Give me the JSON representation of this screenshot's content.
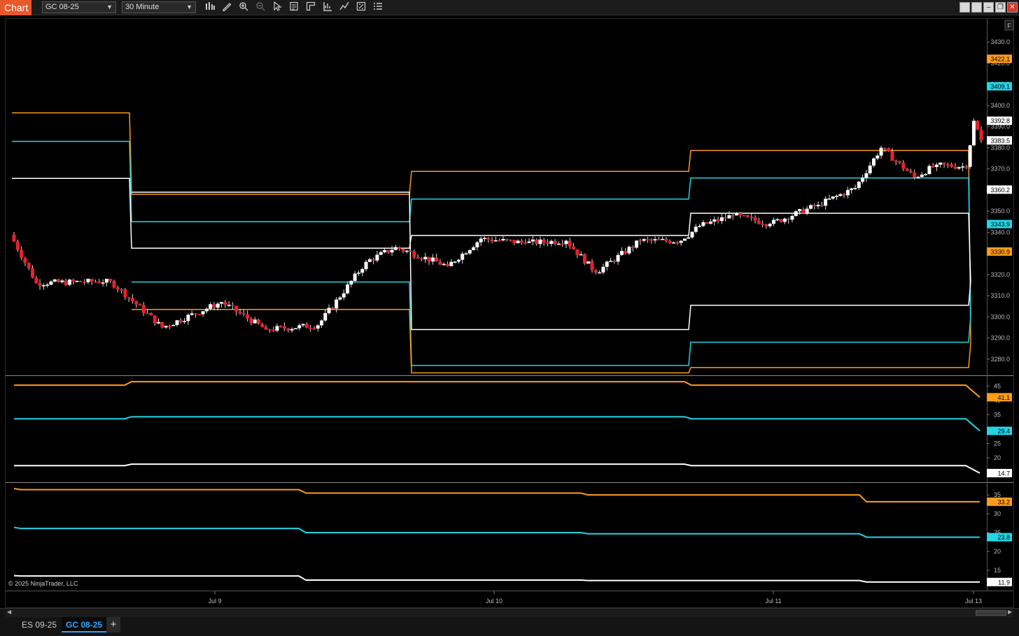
{
  "window": {
    "title": "Chart",
    "instrument": "GC 08-25",
    "interval": "30 Minute",
    "toolbar_icons": [
      "bar-type-icon",
      "draw-tool-icon",
      "zoom-in-icon",
      "zoom-out-icon",
      "pointer-icon",
      "data-box-icon",
      "templates-icon",
      "strategies-icon",
      "indicators-icon",
      "properties-icon",
      "menu-icon"
    ],
    "window_buttons": [
      "tile-icon",
      "restore-icon",
      "minimize-icon",
      "maximize-icon",
      "close-icon"
    ]
  },
  "colors": {
    "background": "#000000",
    "orange": "#ff9c1a",
    "cyan": "#22d6e6",
    "white": "#ffffff",
    "bull_candle": "#ffffff",
    "bear_candle": "#e8202a",
    "accent": "#e8582b",
    "tab_active": "#2fa6ff"
  },
  "chart_data": [
    {
      "type": "candlestick",
      "panel": "price",
      "instrument": "GC 08-25",
      "interval": "30 Minute",
      "x_ticks": [
        "Jul 9",
        "Jul 10",
        "Jul 11",
        "Jul 13"
      ],
      "y_ticks": [
        3280.0,
        3290.0,
        3300.0,
        3310.0,
        3320.0,
        3330.0,
        3340.0,
        3350.0,
        3360.0,
        3370.0,
        3380.0,
        3390.0,
        3400.0,
        3410.0,
        3420.0,
        3430.0
      ],
      "ylim": [
        3273,
        3440
      ],
      "price_markers": [
        {
          "label": "3422.1",
          "color": "orange"
        },
        {
          "label": "3409.1",
          "color": "cyan"
        },
        {
          "label": "3392.8",
          "color": "white"
        },
        {
          "label": "3383.5",
          "color": "white"
        },
        {
          "label": "3360.2",
          "color": "white"
        },
        {
          "label": "3343.9",
          "color": "cyan"
        },
        {
          "label": "3330.9",
          "color": "orange"
        }
      ],
      "series": [
        {
          "color": "orange",
          "segments": [
            [
              3396.5,
              3358.0
            ],
            [
              3358.0,
              3368.8
            ],
            [
              3368.8,
              3378.7
            ],
            [
              3378.7,
              3287.6
            ],
            [
              3287.6,
              3422.1
            ]
          ]
        },
        {
          "color": "cyan",
          "segments": [
            [
              3383.0,
              3345.0
            ],
            [
              3345.0,
              3355.7
            ],
            [
              3355.7,
              3365.7
            ],
            [
              3365.7,
              3300.7
            ],
            [
              3300.7,
              3409.1
            ]
          ]
        },
        {
          "color": "white",
          "segments": [
            [
              3365.5,
              3332.5
            ],
            [
              3332.5,
              3338.5
            ],
            [
              3338.5,
              3349.0
            ],
            [
              3349.0,
              3316.7
            ],
            [
              3316.7,
              3392.8
            ]
          ]
        },
        {
          "color": "white",
          "segments": [
            [
              3359.0,
              3294.0
            ],
            [
              3294.0,
              3305.5
            ],
            [
              3305.5,
              3316.7
            ]
          ]
        },
        {
          "color": "cyan",
          "segments": [
            [
              3316.5,
              3277.0
            ],
            [
              3277.0,
              3288.0
            ],
            [
              3288.0,
              3300.7
            ]
          ]
        },
        {
          "color": "orange",
          "segments": [
            [
              3303.5,
              3273.5
            ],
            [
              3273.5,
              3276.0
            ],
            [
              3276.0,
              3287.6
            ]
          ]
        }
      ],
      "ohlc_segments": [
        {
          "start": 3339,
          "end": 3316,
          "low": 3305,
          "high": 3341
        },
        {
          "start": 3316,
          "end": 3317,
          "low": 3310,
          "high": 3318
        },
        {
          "start": 3317,
          "end": 3295,
          "low": 3292,
          "high": 3318
        },
        {
          "start": 3295,
          "end": 3307,
          "low": 3292,
          "high": 3307
        },
        {
          "start": 3307,
          "end": 3294,
          "low": 3290,
          "high": 3308
        },
        {
          "start": 3294,
          "end": 3296,
          "low": 3291,
          "high": 3310
        },
        {
          "start": 3296,
          "end": 3326,
          "low": 3294,
          "high": 3327
        },
        {
          "start": 3326,
          "end": 3333,
          "low": 3324,
          "high": 3336
        },
        {
          "start": 3333,
          "end": 3324,
          "low": 3322,
          "high": 3335
        },
        {
          "start": 3324,
          "end": 3337,
          "low": 3322,
          "high": 3338
        },
        {
          "start": 3337,
          "end": 3335,
          "low": 3332,
          "high": 3340
        },
        {
          "start": 3335,
          "end": 3336,
          "low": 3329,
          "high": 3340
        },
        {
          "start": 3336,
          "end": 3321,
          "low": 3319,
          "high": 3340
        },
        {
          "start": 3321,
          "end": 3336,
          "low": 3320,
          "high": 3337
        },
        {
          "start": 3336,
          "end": 3336,
          "low": 3333,
          "high": 3338
        },
        {
          "start": 3336,
          "end": 3343,
          "low": 3337,
          "high": 3344
        },
        {
          "start": 3343,
          "end": 3348,
          "low": 3340,
          "high": 3350
        },
        {
          "start": 3348,
          "end": 3344,
          "low": 3341,
          "high": 3355
        },
        {
          "start": 3344,
          "end": 3353,
          "low": 3342,
          "high": 3355
        },
        {
          "start": 3353,
          "end": 3361,
          "low": 3350,
          "high": 3366
        },
        {
          "start": 3361,
          "end": 3380,
          "low": 3360,
          "high": 3381
        },
        {
          "start": 3380,
          "end": 3366,
          "low": 3362,
          "high": 3381
        },
        {
          "start": 3366,
          "end": 3372,
          "low": 3364,
          "high": 3374
        },
        {
          "start": 3372,
          "end": 3371,
          "low": 3368,
          "high": 3373
        },
        {
          "start": 3371,
          "end": 3392.8,
          "low": 3368,
          "high": 3394
        },
        {
          "start": 3392.8,
          "end": 3383.5,
          "low": 3381,
          "high": 3393
        }
      ],
      "candle_counts": [
        7,
        20,
        14,
        16,
        12,
        14,
        13,
        8,
        14,
        9,
        12,
        11,
        8,
        12,
        11,
        5,
        9,
        10,
        13,
        10,
        7,
        9,
        6,
        8,
        2,
        2
      ]
    },
    {
      "type": "line",
      "panel": "indicator-1",
      "y_ticks": [
        20,
        25,
        30,
        35,
        40,
        45
      ],
      "ylim": [
        12,
        48
      ],
      "price_markers": [
        {
          "label": "41.1",
          "color": "orange"
        },
        {
          "label": "29.4",
          "color": "cyan"
        },
        {
          "label": "14.7",
          "color": "white"
        }
      ],
      "series": [
        {
          "color": "orange",
          "levels": [
            45.3,
            46.5,
            46.5,
            45.3,
            45.3,
            41.1
          ]
        },
        {
          "color": "cyan",
          "levels": [
            33.6,
            34.3,
            34.3,
            33.6,
            33.6,
            29.4
          ]
        },
        {
          "color": "white",
          "levels": [
            17.3,
            17.8,
            17.8,
            17.3,
            17.3,
            14.7
          ]
        }
      ]
    },
    {
      "type": "line",
      "panel": "indicator-2",
      "y_ticks": [
        15,
        20,
        25,
        30,
        35
      ],
      "ylim": [
        10,
        38
      ],
      "price_markers": [
        {
          "label": "33.2",
          "color": "orange"
        },
        {
          "label": "23.8",
          "color": "cyan"
        },
        {
          "label": "11.9",
          "color": "white"
        }
      ],
      "series": [
        {
          "color": "orange",
          "levels": [
            36.7,
            36.4,
            35.5,
            35.0,
            33.2
          ]
        },
        {
          "color": "cyan",
          "levels": [
            26.4,
            26.1,
            25.0,
            24.7,
            23.8
          ]
        },
        {
          "color": "white",
          "levels": [
            13.6,
            13.5,
            12.4,
            12.3,
            11.9
          ]
        }
      ]
    }
  ],
  "copyright": "© 2025 NinjaTrader, LLC",
  "tabs": [
    {
      "label": "ES 09-25",
      "active": false
    },
    {
      "label": "GC 08-25",
      "active": true
    }
  ],
  "add_tab_label": "+",
  "panel_corner_label": "F"
}
